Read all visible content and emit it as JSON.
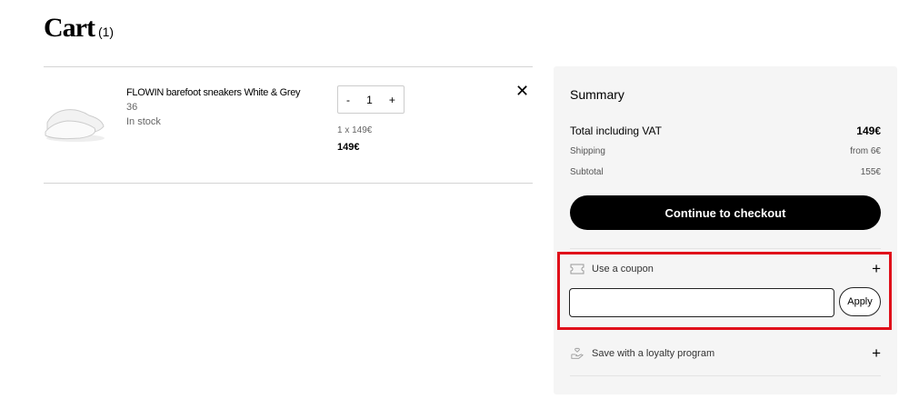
{
  "header": {
    "title": "Cart",
    "count": "(1)"
  },
  "item": {
    "name": "FLOWIN barefoot sneakers White & Grey",
    "size": "36",
    "stock": "In stock",
    "quantity": "1",
    "minus": "-",
    "plus": "+",
    "unit_price": "1 x 149€",
    "total": "149€",
    "remove": "✕"
  },
  "summary": {
    "title": "Summary",
    "total_label": "Total including VAT",
    "total_value": "149€",
    "shipping_label": "Shipping",
    "shipping_value": "from 6€",
    "subtotal_label": "Subtotal",
    "subtotal_value": "155€",
    "checkout_label": "Continue to checkout"
  },
  "coupon": {
    "label": "Use a coupon",
    "toggle": "+",
    "input_value": "",
    "apply_label": "Apply"
  },
  "loyalty": {
    "label": "Save with a loyalty program",
    "toggle": "+"
  }
}
